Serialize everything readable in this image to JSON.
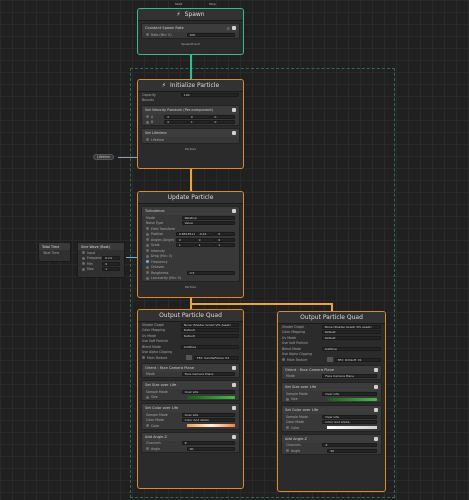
{
  "spawn": {
    "top_ports": [
      "Start",
      "Stop"
    ],
    "title": "Spawn",
    "block_title": "Constant Spawn Rate",
    "rate_label": "Rate (Min: 0)",
    "rate_value": "200",
    "footer": "SpawnEvent"
  },
  "initialize": {
    "title": "Initialize Particle",
    "capacity_label": "Capacity",
    "capacity_value": "100",
    "bounds_label": "Bounds",
    "velocity_block": "Set Velocity Random (Per-component)",
    "vel_a": [
      "0",
      "0",
      "0"
    ],
    "vel_b": [
      "0",
      "1",
      "0"
    ],
    "vel_a_label": "A",
    "vel_b_label": "B",
    "lifetime_block": "Set Lifetime",
    "lifetime_label": "Lifetime",
    "footer": "Particle"
  },
  "lifetime_pill": "Lifetime",
  "update": {
    "title": "Update Particle",
    "block_title": "Turbulence",
    "mode_label": "Mode",
    "mode_value": "Relative",
    "noise_label": "Noise Type",
    "noise_value": "Value",
    "field_label": "Field Transform",
    "position_label": "Position",
    "position_values": [
      "0.8813511",
      "-0.24",
      "0"
    ],
    "angles_label": "Angles (Angle)",
    "angles_values": [
      "0",
      "0",
      "0"
    ],
    "scale_label": "Scale",
    "scale_values": [
      "1",
      "1",
      "1"
    ],
    "intensity_label": "Intensity",
    "drag_label": "Drag (Min: 0)",
    "frequency_label": "Frequency",
    "octaves_label": "Octaves",
    "roughness_label": "Roughness",
    "roughness_value": "0.5",
    "lacunarity_label": "Lacunarity (Min: 0)",
    "footer": "Particle"
  },
  "total_time": {
    "title": "Total Time",
    "output": "Total Time"
  },
  "sine_wave": {
    "title": "Sine Wave (float)",
    "input_label": "Input",
    "frequency_label": "Frequency",
    "frequency_value": "0.14",
    "min_label": "Min",
    "min_value": "0",
    "max_label": "Max",
    "max_value": "1"
  },
  "output_left": {
    "title": "Output Particle Quad",
    "shader_label": "Shader Graph",
    "shader_value": "None (Shader Graph Vfx Asset)",
    "color_mapping_label": "Color Mapping",
    "color_mapping_value": "Default",
    "uv_mode_label": "Uv Mode",
    "uv_mode_value": "Default",
    "soft_label": "Use Soft Particle",
    "blend_label": "Blend Mode",
    "blend_value": "Additive",
    "alpha_label": "Use Alpha Clipping",
    "texture_label": "Main Texture",
    "texture_value": "TEX_CandleFlame_03",
    "orient_block": "Orient : Face Camera Plane",
    "orient_mode_label": "Mode",
    "orient_mode_value": "Face Camera Plane",
    "size_block": "Set Size over Life",
    "size_sample_label": "Sample Mode",
    "size_sample_value": "Over Life",
    "size_label": "Size",
    "color_block": "Set Color over Life",
    "color_sample_label": "Sample Mode",
    "color_sample_value": "Over Life",
    "color_mode_label": "Color Mode",
    "color_mode_value": "Color And Alpha",
    "color_label": "Color",
    "angle_block": "Add Angle.Z",
    "channels_label": "Channels",
    "channels_value": "Z",
    "angle_label": "Angle",
    "angle_value": "90"
  },
  "output_right": {
    "title": "Output Particle Quad",
    "shader_label": "Shader Graph",
    "shader_value": "None (Shader Graph Vfx Asset)",
    "color_mapping_label": "Color Mapping",
    "color_mapping_value": "Default",
    "uv_mode_label": "Uv Mode",
    "uv_mode_value": "Default",
    "soft_label": "Use Soft Particle",
    "blend_label": "Blend Mode",
    "blend_value": "Additive",
    "alpha_label": "Use Alpha Clipping",
    "texture_label": "Main Texture",
    "texture_value": "TEX_OrbSoft_01",
    "orient_block": "Orient : Face Camera Plane",
    "orient_mode_label": "Mode",
    "orient_mode_value": "Face Camera Plane",
    "size_block": "Set Size over Life",
    "size_sample_label": "Sample Mode",
    "size_sample_value": "Over Life",
    "size_label": "Size",
    "color_block": "Set Color over Life",
    "color_sample_label": "Sample Mode",
    "color_sample_value": "Over Life",
    "color_mode_label": "Color Mode",
    "color_mode_value": "Color And Alpha",
    "color_label": "Color",
    "angle_block": "Add Angle.Z",
    "channels_label": "Channels",
    "channels_value": "Z",
    "angle_label": "Angle",
    "angle_value": "90"
  },
  "colors": {
    "context_border": "#d98c2b",
    "spawn_border": "#2fbf8a",
    "flow_wire": "#e8a63a"
  },
  "icons": [
    "lightning-icon",
    "gear-icon",
    "checkbox-icon"
  ]
}
